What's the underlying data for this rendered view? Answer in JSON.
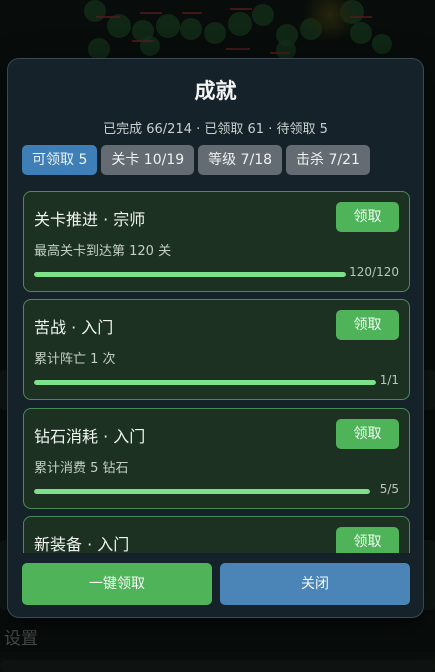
{
  "background": {
    "settings_label": "设置"
  },
  "modal": {
    "title": "成就",
    "summary": "已完成 66/214 · 已领取 61 · 待领取 5",
    "tabs": [
      {
        "label": "可领取 5",
        "active": true
      },
      {
        "label": "关卡 10/19",
        "active": false
      },
      {
        "label": "等级 7/18",
        "active": false
      },
      {
        "label": "击杀 7/21",
        "active": false
      }
    ],
    "achievements": [
      {
        "title": "关卡推进 · 宗师",
        "desc": "最高关卡到达第 120 关",
        "progress_text": "120/120",
        "progress": 1.0,
        "button": "领取"
      },
      {
        "title": "苦战 · 入门",
        "desc": "累计阵亡 1 次",
        "progress_text": "1/1",
        "progress": 1.0,
        "button": "领取"
      },
      {
        "title": "钻石消耗 · 入门",
        "desc": "累计消费 5 钻石",
        "progress_text": "5/5",
        "progress": 1.0,
        "button": "领取"
      },
      {
        "title": "新装备 · 入门",
        "desc": "",
        "progress_text": "",
        "progress": 1.0,
        "button": "领取"
      }
    ],
    "footer": {
      "claim_all": "一键领取",
      "close": "关闭"
    }
  },
  "colors": {
    "accent_green": "#4fb35a",
    "accent_blue": "#3f7fb8",
    "progress_fill": "#7de08a"
  }
}
